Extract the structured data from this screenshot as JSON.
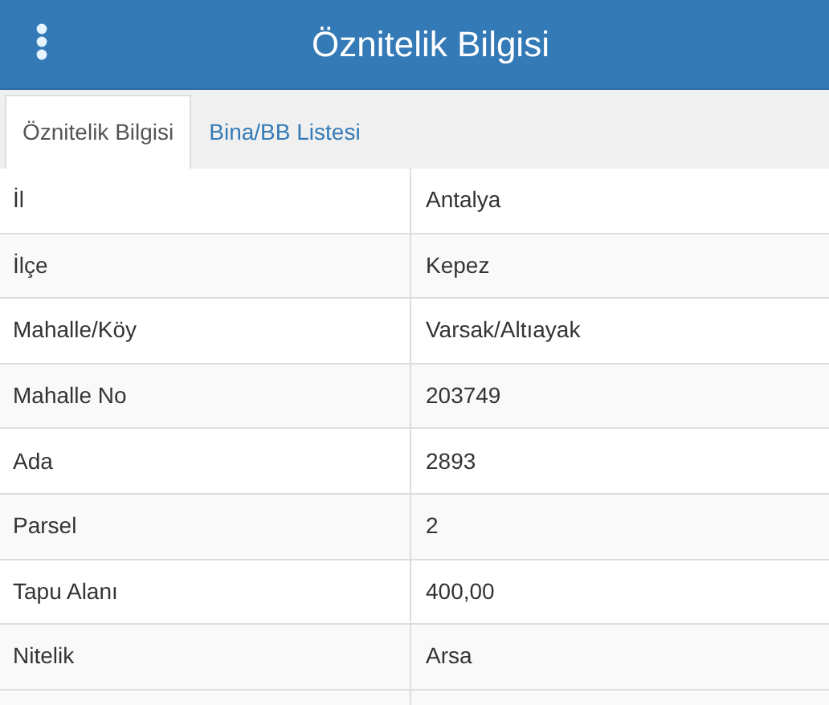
{
  "header": {
    "title": "Öznitelik Bilgisi"
  },
  "tabs": [
    {
      "label": "Öznitelik Bilgisi",
      "selected": true
    },
    {
      "label": "Bina/BB Listesi",
      "selected": false
    }
  ],
  "rows": [
    {
      "label": "İl",
      "value": "Antalya"
    },
    {
      "label": "İlçe",
      "value": "Kepez"
    },
    {
      "label": "Mahalle/Köy",
      "value": "Varsak/Altıayak"
    },
    {
      "label": "Mahalle No",
      "value": "203749"
    },
    {
      "label": "Ada",
      "value": "2893"
    },
    {
      "label": "Parsel",
      "value": "2"
    },
    {
      "label": "Tapu Alanı",
      "value": "400,00"
    },
    {
      "label": "Nitelik",
      "value": "Arsa"
    }
  ]
}
